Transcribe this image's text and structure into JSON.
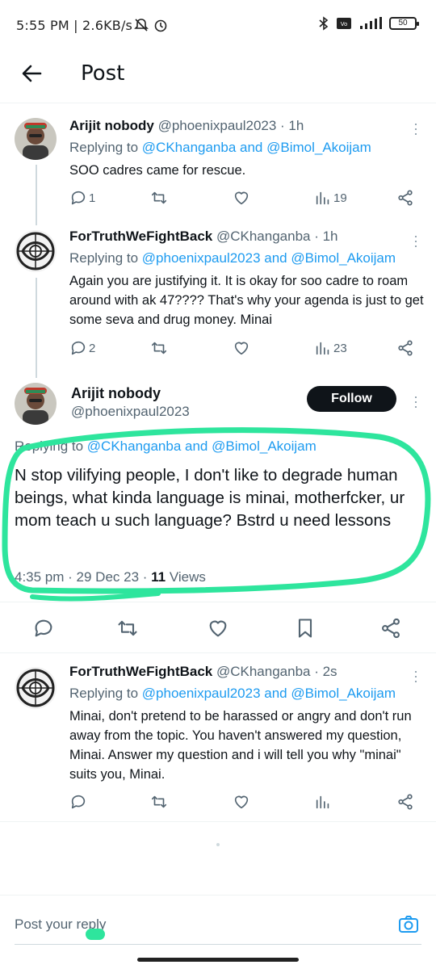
{
  "status_bar": {
    "left": "5:55 PM | 2.6KB/s",
    "battery": "50"
  },
  "header": {
    "title": "Post"
  },
  "tweets": [
    {
      "name": "Arijit nobody",
      "handle_time": "@phoenixpaul2023 · 1h",
      "replying_prefix": "Replying to ",
      "replying_to": "@CKhanganba and @Bimol_Akoijam",
      "text": "SOO cadres came for rescue.",
      "replies": "1",
      "views": "19"
    },
    {
      "name": "ForTruthWeFightBack",
      "handle_time": "@CKhanganba · 1h",
      "replying_prefix": "Replying to ",
      "replying_to": "@phoenixpaul2023 and @Bimol_Akoijam",
      "text": "Again you are justifying it. It is okay for soo cadre to roam around with ak 47???? That's why your agenda is just to get some seva and drug money. Minai",
      "replies": "2",
      "views": "23"
    }
  ],
  "main_post": {
    "name": "Arijit nobody",
    "handle": "@phoenixpaul2023",
    "follow_label": "Follow",
    "replying_prefix": "Replying to ",
    "replying_to": "@CKhanganba and @Bimol_Akoijam",
    "text": "N stop vilifying people, I don't like to degrade human beings, what kinda language is minai, motherfcker, ur mom teach u such language? Bstrd u need lessons",
    "time_date": "4:35 pm · 29 Dec 23 · ",
    "views_count": "11",
    "views_label": " Views",
    "highlight_color": "#2ee59d"
  },
  "reply_tweet": {
    "name": "ForTruthWeFightBack",
    "handle_time": "@CKhanganba · 2s",
    "replying_prefix": "Replying to ",
    "replying_to": "@phoenixpaul2023 and @Bimol_Akoijam",
    "text": "Minai, don't pretend to be harassed or angry and don't run away from the topic. You haven't answered my question, Minai. Answer my question and i will tell you why \"minai\" suits you, Minai."
  },
  "reply_bar": {
    "placeholder": "Post your reply"
  },
  "colors": {
    "accent": "#1d9bf0",
    "muted": "#536471",
    "text": "#0f1419"
  }
}
